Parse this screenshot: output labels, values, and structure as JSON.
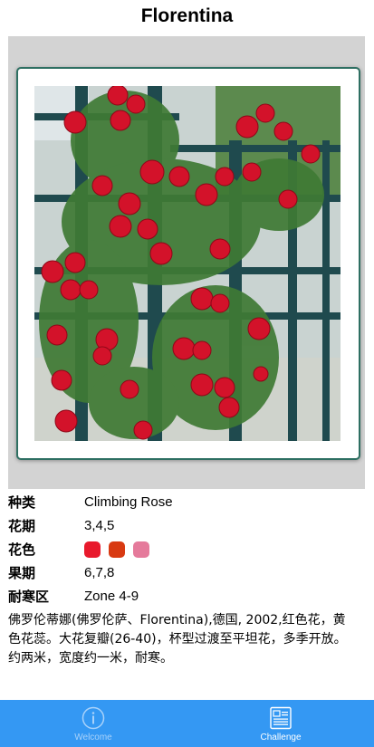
{
  "header": {
    "title": "Florentina"
  },
  "details": {
    "type_label": "种类",
    "type_value": "Climbing Rose",
    "bloom_label": "花期",
    "bloom_value": "3,4,5",
    "color_label": "花色",
    "colors": [
      "#e8192c",
      "#d83a12",
      "#e57a9b"
    ],
    "fruit_label": "果期",
    "fruit_value": "6,7,8",
    "hardiness_label": "耐寒区",
    "hardiness_value": "Zone 4-9"
  },
  "description": "佛罗伦蒂娜(佛罗伦萨、Florentina),德国, 2002,红色花，黄色花蕊。大花复瓣(26-40)，杯型过渡至平坦花，多季开放。约两米，宽度约一米，耐寒。",
  "tabbar": {
    "tabs": [
      {
        "label": "Welcome",
        "icon": "info-icon",
        "selected": false
      },
      {
        "label": "Challenge",
        "icon": "document-icon",
        "selected": true
      }
    ],
    "background": "#3498f3"
  }
}
